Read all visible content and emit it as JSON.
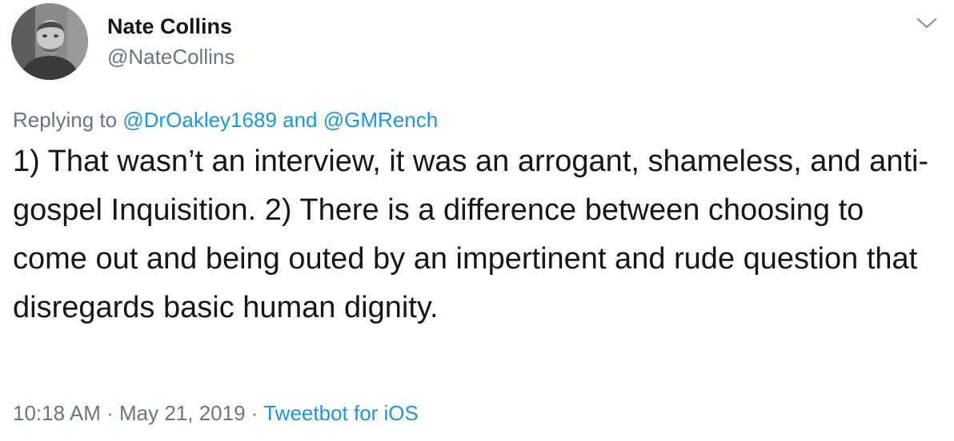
{
  "author": {
    "display_name": "Nate Collins",
    "handle": "@NateCollins"
  },
  "reply": {
    "prefix": "Replying to",
    "mention_1": "@DrOakley1689",
    "conjunction": "and",
    "mention_2": "@GMRench"
  },
  "tweet": {
    "text": "1) That wasn’t an interview, it was an arrogant, shameless, and anti-gospel Inquisition. 2) There is a difference between choosing to come out and being outed by an impertinent and rude question that disregards basic human dignity."
  },
  "meta": {
    "time": "10:18 AM",
    "separator_1": "·",
    "date": "May 21, 2019",
    "separator_2": "·",
    "source": "Tweetbot for iOS"
  },
  "icons": {
    "menu": "chevron-down-icon"
  },
  "colors": {
    "text": "#14171a",
    "secondary": "#657786",
    "link": "#1b95e0"
  }
}
